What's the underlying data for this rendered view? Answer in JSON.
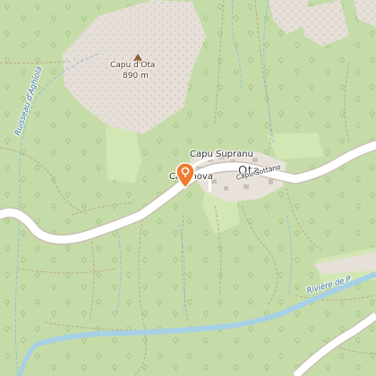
{
  "map": {
    "colors": {
      "background": "#c9deab",
      "forest": "#bfd8a0",
      "meadow": "#d2e6b4",
      "rock": "#e3ddd6",
      "road": "#ffffff",
      "road_casing": "#c7bfb0",
      "river": "#a9d3e8",
      "stream": "#8ec3de",
      "settlement": "#e6e0d8",
      "marker": "#f07a2e"
    },
    "peak": {
      "name": "Capu d'Ota",
      "elevation": "890 m",
      "icon": "peak-triangle-icon"
    },
    "villages": {
      "supranu": "Capu Supranu",
      "ota": "Ota",
      "casanova": "Casanova",
      "sottano": "Capu Sottano"
    },
    "waterways": {
      "stream": "Ruisseau d'Aghiola",
      "river": "Rivière de P"
    },
    "marker": {
      "icon": "location-pin-icon"
    }
  }
}
